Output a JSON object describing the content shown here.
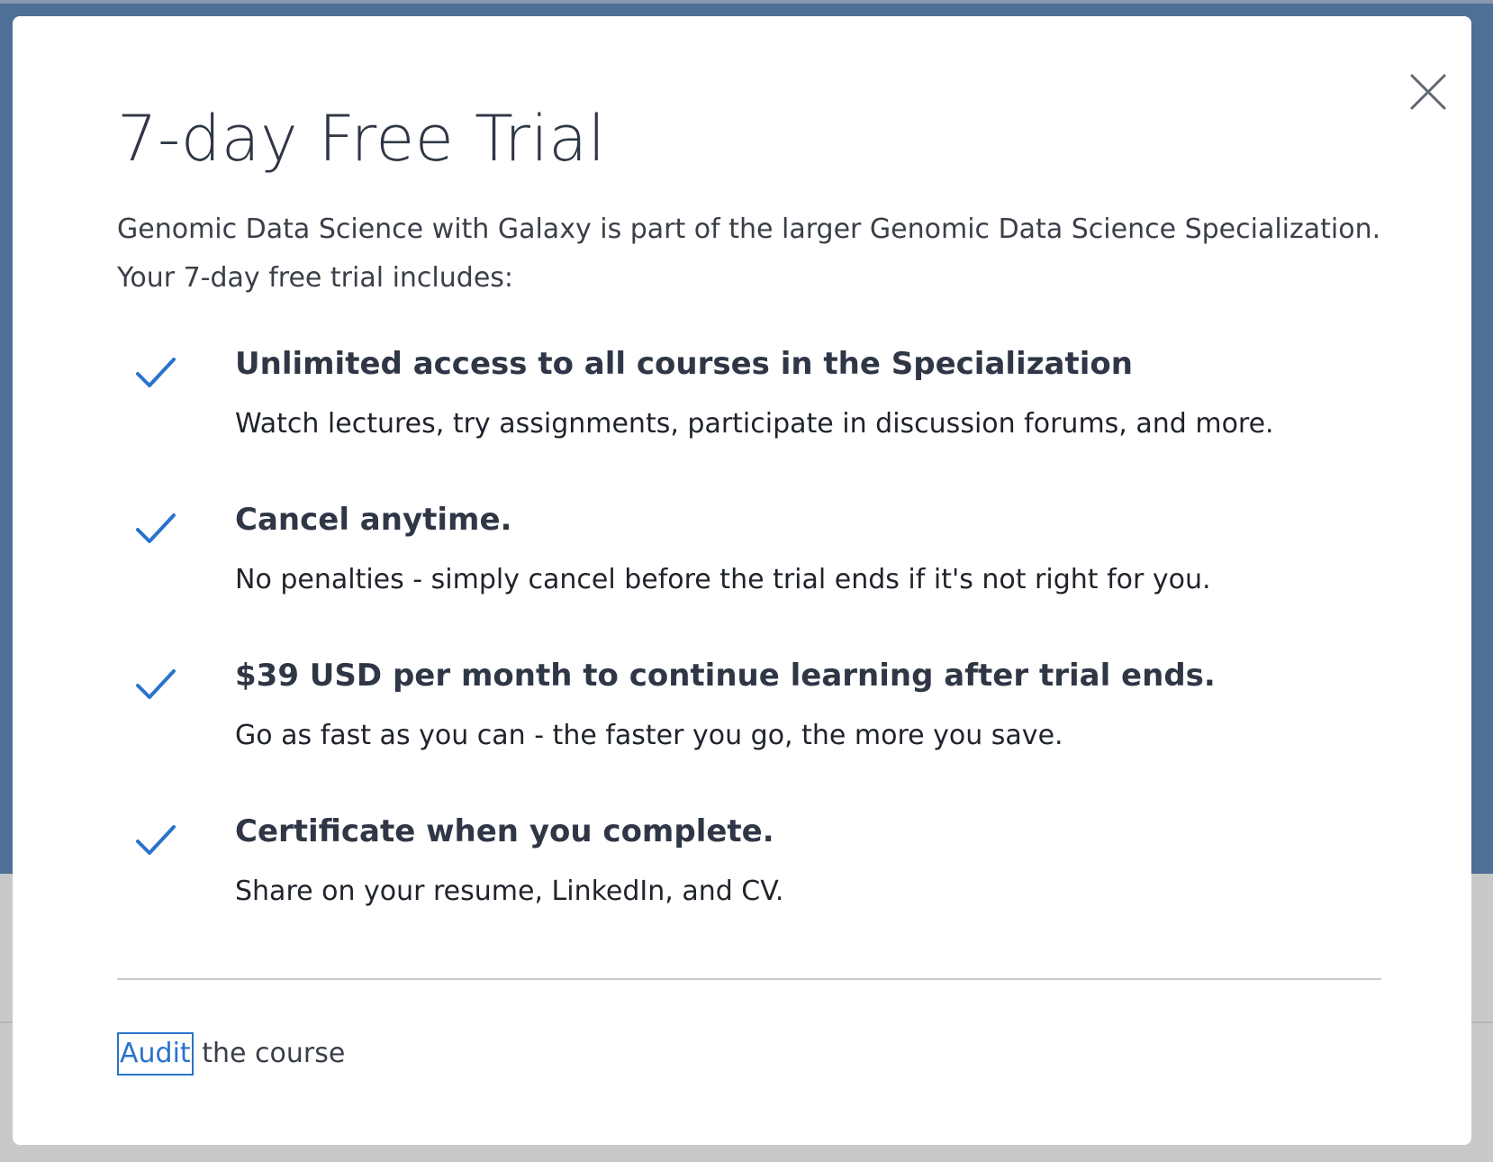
{
  "modal": {
    "title": "7-day Free Trial",
    "subtitle_line1": "Genomic Data Science with Galaxy is part of the larger Genomic Data Science Specialization.",
    "subtitle_line2": "Your 7-day free trial includes:",
    "close_icon": "close-icon",
    "features": [
      {
        "icon": "checkmark-icon",
        "title": "Unlimited access to all courses in the Specialization",
        "description": "Watch lectures, try assignments, participate in discussion forums, and more."
      },
      {
        "icon": "checkmark-icon",
        "title": "Cancel anytime.",
        "description": "No penalties - simply cancel before the trial ends if it's not right for you."
      },
      {
        "icon": "checkmark-icon",
        "title": "$39 USD per month to continue learning after trial ends.",
        "description": "Go as fast as you can - the faster you go, the more you save."
      },
      {
        "icon": "checkmark-icon",
        "title": "Certificate when you complete.",
        "description": "Share on your resume, LinkedIn, and CV."
      }
    ],
    "audit": {
      "link_label": "Audit",
      "rest_text": " the course"
    }
  },
  "colors": {
    "accent": "#2a73cc",
    "backdrop": "#4e6f96",
    "heading": "#2f3746"
  }
}
